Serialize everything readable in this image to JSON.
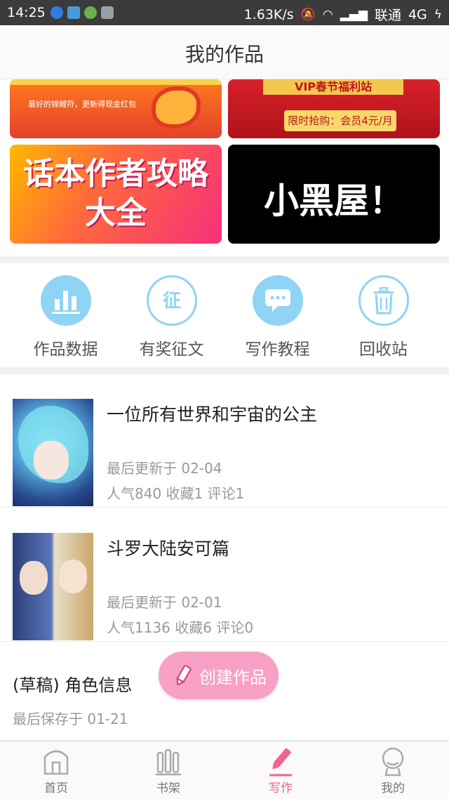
{
  "status_bar": {
    "time": "14:25",
    "network_speed": "1.63K/s",
    "carrier": "联通",
    "network_type": "4G"
  },
  "header": {
    "title": "我的作品"
  },
  "banners": {
    "top_left_small": "最好的锦鲤符，更新得现金红包",
    "top_right_title": "VIP春节福利站",
    "top_right_pill": "限时抢购：会员4元/月",
    "bottom_left": "话本作者攻略大全",
    "bottom_right": "小黑屋！"
  },
  "quick_actions": [
    {
      "label": "作品数据",
      "icon": "bar-chart-icon"
    },
    {
      "label": "有奖征文",
      "icon": "zheng-badge-icon"
    },
    {
      "label": "写作教程",
      "icon": "chat-bubble-icon"
    },
    {
      "label": "回收站",
      "icon": "trash-icon"
    }
  ],
  "works": [
    {
      "title": "一位所有世界和宇宙的公主",
      "updated": "最后更新于 02-04",
      "stats": "人气840  收藏1  评论1"
    },
    {
      "title": "斗罗大陆安可篇",
      "updated": "最后更新于 02-01",
      "stats": "人气1136  收藏6  评论0"
    }
  ],
  "draft": {
    "title": "(草稿) 角色信息",
    "saved": "最后保存于 01-21"
  },
  "fab": {
    "label": "创建作品"
  },
  "bottom_nav": [
    {
      "label": "首页",
      "icon": "home-icon"
    },
    {
      "label": "书架",
      "icon": "bookshelf-icon"
    },
    {
      "label": "写作",
      "icon": "pencil-icon",
      "active": true
    },
    {
      "label": "我的",
      "icon": "profile-icon"
    }
  ],
  "colors": {
    "accent_pink": "#f06292",
    "fab_pink": "#f9a0c6",
    "action_blue": "#8fd3f5",
    "status_bar": "#3b3b3b"
  }
}
